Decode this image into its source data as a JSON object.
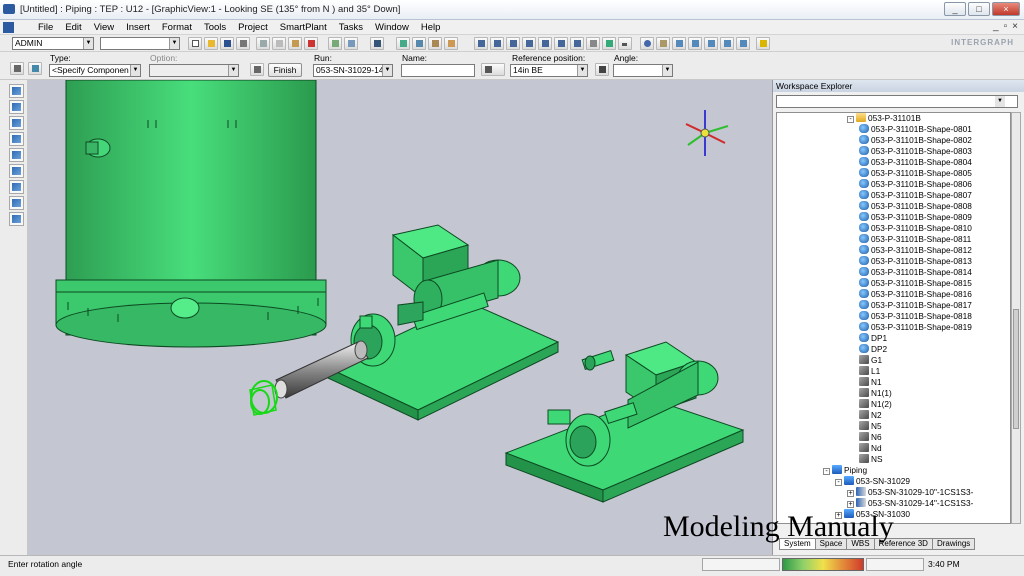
{
  "window": {
    "title": "[Untitled] : Piping : TEP : U12 - [GraphicView:1 - Looking SE (135° from N ) and 35° Down]",
    "controls": [
      "_",
      "□",
      "×"
    ],
    "mdi_controls": [
      "_",
      "▫",
      "×"
    ]
  },
  "menu": [
    "File",
    "Edit",
    "View",
    "Insert",
    "Format",
    "Tools",
    "Project",
    "SmartPlant",
    "Tasks",
    "Window",
    "Help"
  ],
  "toolbar": {
    "user_combo": "ADMIN",
    "second_combo": "",
    "brand": "INTERGRAPH"
  },
  "ribbon": {
    "type_label": "Type:",
    "type_value": "<Specify Componen",
    "option_label": "Option:",
    "option_value": "",
    "finish_label": "Finish",
    "run_label": "Run:",
    "run_value": "053-SN-31029-14",
    "name_label": "Name:",
    "name_value": "",
    "ref_label": "Reference position:",
    "ref_value": "14in  BE",
    "angle_label": "Angle:",
    "angle_value": ""
  },
  "explorer": {
    "title": "Workspace Explorer",
    "tree": [
      {
        "label": "053-P-31101B",
        "level": 0,
        "icon": "folder",
        "expander": "-"
      },
      {
        "label": "053-P-31101B-Shape-0801",
        "level": 1,
        "icon": "shape"
      },
      {
        "label": "053-P-31101B-Shape-0802",
        "level": 1,
        "icon": "shape"
      },
      {
        "label": "053-P-31101B-Shape-0803",
        "level": 1,
        "icon": "shape"
      },
      {
        "label": "053-P-31101B-Shape-0804",
        "level": 1,
        "icon": "shape"
      },
      {
        "label": "053-P-31101B-Shape-0805",
        "level": 1,
        "icon": "shape"
      },
      {
        "label": "053-P-31101B-Shape-0806",
        "level": 1,
        "icon": "shape"
      },
      {
        "label": "053-P-31101B-Shape-0807",
        "level": 1,
        "icon": "shape"
      },
      {
        "label": "053-P-31101B-Shape-0808",
        "level": 1,
        "icon": "shape"
      },
      {
        "label": "053-P-31101B-Shape-0809",
        "level": 1,
        "icon": "shape"
      },
      {
        "label": "053-P-31101B-Shape-0810",
        "level": 1,
        "icon": "shape"
      },
      {
        "label": "053-P-31101B-Shape-0811",
        "level": 1,
        "icon": "shape"
      },
      {
        "label": "053-P-31101B-Shape-0812",
        "level": 1,
        "icon": "shape"
      },
      {
        "label": "053-P-31101B-Shape-0813",
        "level": 1,
        "icon": "shape"
      },
      {
        "label": "053-P-31101B-Shape-0814",
        "level": 1,
        "icon": "shape"
      },
      {
        "label": "053-P-31101B-Shape-0815",
        "level": 1,
        "icon": "shape"
      },
      {
        "label": "053-P-31101B-Shape-0816",
        "level": 1,
        "icon": "shape"
      },
      {
        "label": "053-P-31101B-Shape-0817",
        "level": 1,
        "icon": "shape"
      },
      {
        "label": "053-P-31101B-Shape-0818",
        "level": 1,
        "icon": "shape"
      },
      {
        "label": "053-P-31101B-Shape-0819",
        "level": 1,
        "icon": "shape"
      },
      {
        "label": "DP1",
        "level": 1,
        "icon": "shape"
      },
      {
        "label": "DP2",
        "level": 1,
        "icon": "shape"
      },
      {
        "label": "G1",
        "level": 1,
        "icon": "symbol"
      },
      {
        "label": "L1",
        "level": 1,
        "icon": "symbol"
      },
      {
        "label": "N1",
        "level": 1,
        "icon": "symbol"
      },
      {
        "label": "N1(1)",
        "level": 1,
        "icon": "symbol"
      },
      {
        "label": "N1(2)",
        "level": 1,
        "icon": "symbol"
      },
      {
        "label": "N2",
        "level": 1,
        "icon": "symbol"
      },
      {
        "label": "N5",
        "level": 1,
        "icon": "symbol"
      },
      {
        "label": "N6",
        "level": 1,
        "icon": "symbol"
      },
      {
        "label": "Nd",
        "level": 1,
        "icon": "symbol"
      },
      {
        "label": "NS",
        "level": 1,
        "icon": "symbol"
      },
      {
        "label": "Piping",
        "level": -2,
        "icon": "system",
        "expander": "-"
      },
      {
        "label": "053-SN-31029",
        "level": -1,
        "icon": "system",
        "expander": "-"
      },
      {
        "label": "053-SN-31029-10\"-1CS1S3-",
        "level": 0,
        "icon": "pipe",
        "expander": "+"
      },
      {
        "label": "053-SN-31029-14\"-1CS1S3-",
        "level": 0,
        "icon": "pipe",
        "expander": "+"
      },
      {
        "label": "053-SN-31030",
        "level": -1,
        "icon": "system",
        "expander": "+"
      }
    ],
    "tabs": [
      "System",
      "Space",
      "WBS",
      "Reference 3D",
      "Drawings"
    ]
  },
  "status": {
    "prompt": "Enter rotation angle",
    "time": "3:40 PM"
  },
  "overlay": {
    "caption": "Modeling Manualy"
  },
  "colors": {
    "model_green": "#44e27a",
    "model_edge": "#0d4a22",
    "viewport_bg": "#c4c6d1"
  }
}
